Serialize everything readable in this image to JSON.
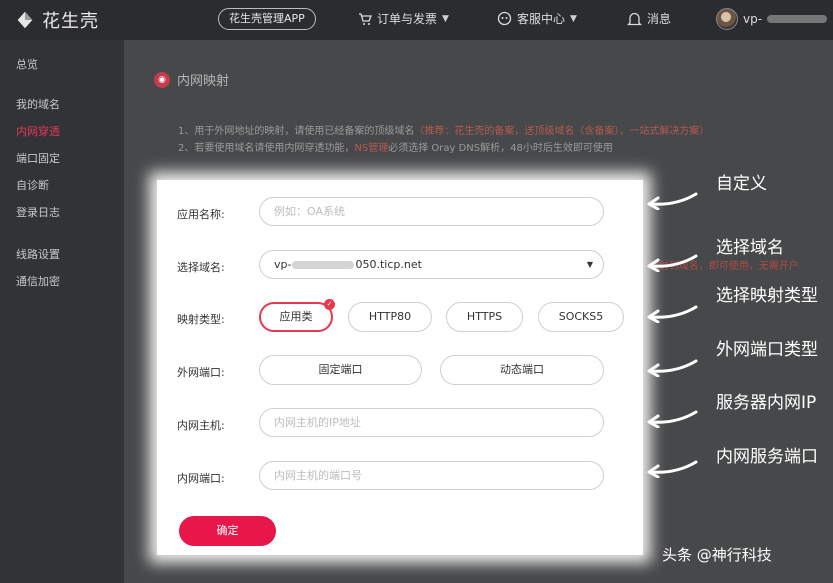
{
  "header": {
    "brand_name": "花生壳",
    "app_button": "花生壳管理APP",
    "menu_orders": "订单与发票",
    "menu_service": "客服中心",
    "menu_messages": "消息",
    "username_prefix": "vp-"
  },
  "sidebar": {
    "items": [
      {
        "label": "总览",
        "active": false
      },
      {
        "label": "我的域名",
        "active": false
      },
      {
        "label": "内网穿透",
        "active": true
      },
      {
        "label": "端口固定",
        "active": false
      },
      {
        "label": "自诊断",
        "active": false
      },
      {
        "label": "登录日志",
        "active": false
      },
      {
        "label": "线路设置",
        "active": false
      },
      {
        "label": "通信加密",
        "active": false
      }
    ]
  },
  "main": {
    "title": "内网映射",
    "notes": {
      "line1_prefix": "1、用于外网地址的映射，请使用已经备案的顶级域名",
      "line1_red": "（推荐：花生壳的备案，送顶级域名（含备案），一站式解决方案）",
      "line2_prefix": "2、若要使用域名请使用内网穿透功能，",
      "line2_red": "NS管理",
      "line2_suffix": "必须选择 Oray DNS解析，48小时后生效即可使用"
    }
  },
  "form": {
    "app_name_label": "应用名称:",
    "app_name_placeholder": "例如：OA系统",
    "domain_label": "选择域名:",
    "domain_prefix": "vp-",
    "domain_suffix": "050.ticp.net",
    "domain_hint": "HTTP 映射到域名，即可使用，无需开户",
    "type_label": "映射类型:",
    "type_options": [
      "应用类",
      "HTTP80",
      "HTTPS",
      "SOCKS5"
    ],
    "type_selected": "应用类",
    "ext_port_label": "外网端口:",
    "ext_port_options": [
      "固定端口",
      "动态端口"
    ],
    "host_label": "内网主机:",
    "host_placeholder": "内网主机的IP地址",
    "port_label": "内网端口:",
    "port_placeholder": "内网主机的端口号",
    "submit_label": "确定"
  },
  "annotations": [
    "自定义",
    "选择域名",
    "选择映射类型",
    "外网端口类型",
    "服务器内网IP",
    "内网服务端口"
  ],
  "watermark": "头条 @神行科技",
  "colors": {
    "accent": "#e7174a",
    "topbar": "#2b2c30",
    "sidebar": "#323337"
  }
}
